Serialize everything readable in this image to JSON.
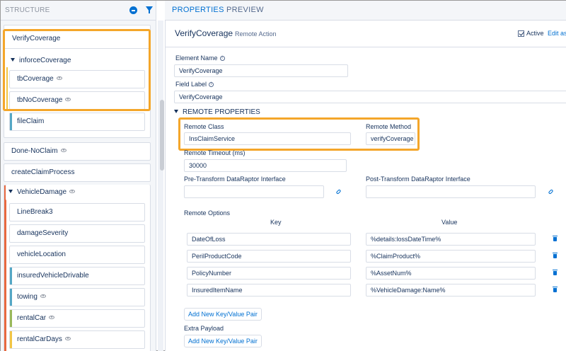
{
  "structure": {
    "title": "STRUCTURE",
    "selected_block": "VerifyCoverage",
    "group": {
      "label": "inforceCoverage",
      "children": [
        "tbCoverage",
        "tbNoCoverage"
      ]
    },
    "file_claim": "fileClaim",
    "done_no_claim": "Done-NoClaim",
    "create_claim_process": "createClaimProcess",
    "vehicle_damage": {
      "label": "VehicleDamage",
      "children": [
        "LineBreak3",
        "damageSeverity",
        "vehicleLocation",
        "insuredVehicleDrivable",
        "towing",
        "rentalCar",
        "rentalCarDays"
      ]
    }
  },
  "tabs": {
    "properties": "PROPERTIES",
    "preview": "PREVIEW"
  },
  "element": {
    "title": "VerifyCoverage",
    "type": "Remote Action",
    "active_label": "Active",
    "edit_link": "Edit as",
    "element_name_label": "Element Name",
    "element_name_value": "VerifyCoverage",
    "field_label_label": "Field Label",
    "field_label_value": "VerifyCoverage"
  },
  "remote": {
    "section_title": "REMOTE PROPERTIES",
    "class_label": "Remote Class",
    "class_value": "InsClaimService",
    "method_label": "Remote Method",
    "method_value": "verifyCoverage",
    "timeout_label": "Remote Timeout (ms)",
    "timeout_value": "30000",
    "pre_transform_label": "Pre-Transform DataRaptor Interface",
    "pre_transform_value": "",
    "post_transform_label": "Post-Transform DataRaptor Interface",
    "post_transform_value": "",
    "options_label": "Remote Options",
    "key_header": "Key",
    "value_header": "Value",
    "options": [
      {
        "key": "DateOfLoss",
        "value": "%details:lossDateTime%"
      },
      {
        "key": "PerilProductCode",
        "value": "%ClaimProduct%"
      },
      {
        "key": "PolicyNumber",
        "value": "%AssetNum%"
      },
      {
        "key": "InsuredItemName",
        "value": "%VehicleDamage:Name%"
      }
    ],
    "add_pair_label": "Add New Key/Value Pair",
    "extra_payload_label": "Extra Payload",
    "add_payload_label": "Add New Key/Value Pair"
  },
  "colors": {
    "accent": "#0070d2",
    "highlight": "#f4a62a",
    "bar_teal": "#54a7c5",
    "bar_orange": "#e8683f",
    "bar_green": "#9ab85a",
    "bar_yellow": "#f2c544"
  },
  "icons": [
    "minus-circle-icon",
    "filter-icon",
    "caret-down-icon",
    "eye-icon",
    "info-icon",
    "checkbox-icon",
    "link-icon",
    "trash-icon"
  ]
}
